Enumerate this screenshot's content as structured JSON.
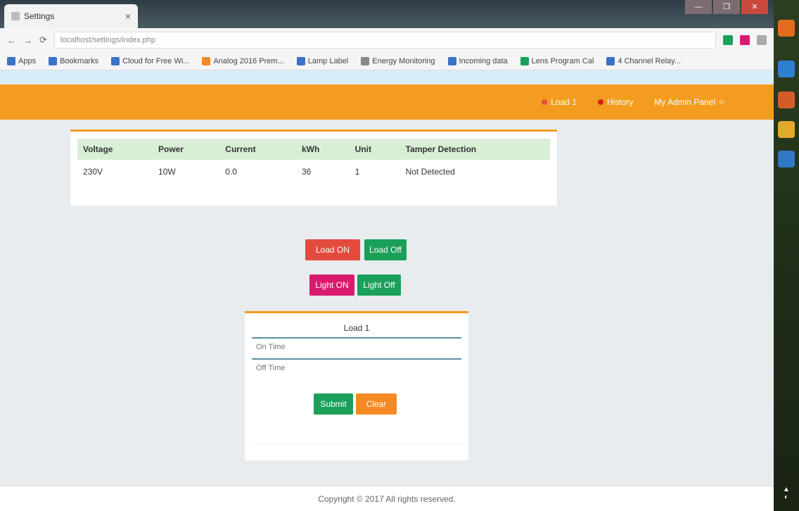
{
  "browser": {
    "tab_title": "Settings",
    "tab_close": "×",
    "url": "localhost/settings/index.php",
    "nav_glyphs": [
      "←",
      "→",
      "⟳"
    ],
    "bookmarks": [
      "Apps",
      "Bookmarks",
      "Cloud for Free Wi...",
      "Analog 2016 Prem...",
      "Lamp Label",
      "Energy Monitoring",
      "Incoming data",
      "Lens Program Cal",
      "4 Channel Relay..."
    ],
    "window_buttons": [
      "—",
      "❐",
      "✕"
    ]
  },
  "navbar": {
    "items": [
      {
        "label": "Load 1",
        "dot_color": "#e24b3d"
      },
      {
        "label": "History",
        "dot_color": "#d81b1b"
      },
      {
        "label": "My Admin Panel",
        "dot_color": ""
      }
    ]
  },
  "table": {
    "headers": [
      "Voltage",
      "Power",
      "Current",
      "kWh",
      "Unit",
      "Tamper Detection"
    ],
    "rows": [
      [
        "230V",
        "10W",
        "0.0",
        "36",
        "1",
        "Not Detected"
      ]
    ]
  },
  "buttons": {
    "on_button": "Load ON",
    "off_button": "Load Off",
    "light_on": "Light ON",
    "light_off": "Light Off",
    "submit": "Submit",
    "clear": "Clear"
  },
  "control_panel": {
    "title": "Load 1",
    "field1_placeholder": "On Time",
    "field2_placeholder": "Off Time"
  },
  "footer": {
    "text": "Copyright © 2017 All rights reserved."
  },
  "colors": {
    "accent": "#f39c1f",
    "table_header": "#d8efd6",
    "btn_red": "#e24b3d",
    "btn_green": "#1ba05a",
    "btn_pink": "#d81b6e",
    "btn_orange": "#f58a24"
  }
}
